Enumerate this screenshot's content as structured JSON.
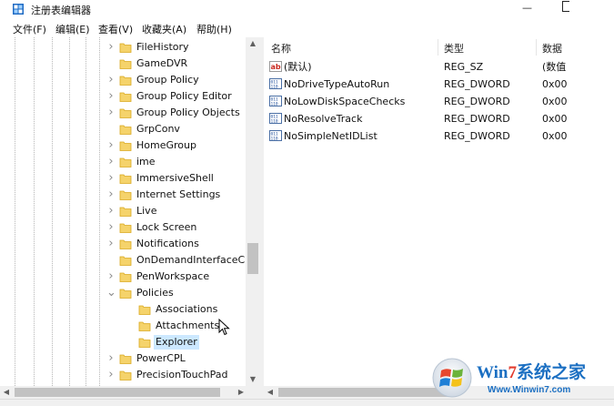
{
  "window": {
    "title": "注册表编辑器",
    "minimize_glyph": "—"
  },
  "menu": {
    "items": [
      "文件(F)",
      "编辑(E)",
      "查看(V)",
      "收藏夹(A)",
      "帮助(H)"
    ]
  },
  "tree": {
    "items": [
      {
        "label": "FileHistory",
        "expander": ">",
        "level": 1
      },
      {
        "label": "GameDVR",
        "expander": "",
        "level": 1
      },
      {
        "label": "Group Policy",
        "expander": ">",
        "level": 1
      },
      {
        "label": "Group Policy Editor",
        "expander": ">",
        "level": 1
      },
      {
        "label": "Group Policy Objects",
        "expander": ">",
        "level": 1
      },
      {
        "label": "GrpConv",
        "expander": "",
        "level": 1
      },
      {
        "label": "HomeGroup",
        "expander": ">",
        "level": 1
      },
      {
        "label": "ime",
        "expander": ">",
        "level": 1
      },
      {
        "label": "ImmersiveShell",
        "expander": ">",
        "level": 1
      },
      {
        "label": "Internet Settings",
        "expander": ">",
        "level": 1
      },
      {
        "label": "Live",
        "expander": ">",
        "level": 1
      },
      {
        "label": "Lock Screen",
        "expander": ">",
        "level": 1
      },
      {
        "label": "Notifications",
        "expander": ">",
        "level": 1
      },
      {
        "label": "OnDemandInterfaceCa",
        "expander": "",
        "level": 1
      },
      {
        "label": "PenWorkspace",
        "expander": ">",
        "level": 1
      },
      {
        "label": "Policies",
        "expander": "v",
        "level": 1
      },
      {
        "label": "Associations",
        "expander": "",
        "level": 2
      },
      {
        "label": "Attachments",
        "expander": "",
        "level": 2
      },
      {
        "label": "Explorer",
        "expander": "",
        "level": 2,
        "selected": true
      },
      {
        "label": "PowerCPL",
        "expander": ">",
        "level": 1
      },
      {
        "label": "PrecisionTouchPad",
        "expander": ">",
        "level": 1
      }
    ]
  },
  "list": {
    "columns": [
      "名称",
      "类型",
      "数据"
    ],
    "rows": [
      {
        "icon": "string-value-icon",
        "name": "(默认)",
        "type": "REG_SZ",
        "data": "(数值"
      },
      {
        "icon": "dword-value-icon",
        "name": "NoDriveTypeAutoRun",
        "type": "REG_DWORD",
        "data": "0x00"
      },
      {
        "icon": "dword-value-icon",
        "name": "NoLowDiskSpaceChecks",
        "type": "REG_DWORD",
        "data": "0x00"
      },
      {
        "icon": "dword-value-icon",
        "name": "NoResolveTrack",
        "type": "REG_DWORD",
        "data": "0x00"
      },
      {
        "icon": "dword-value-icon",
        "name": "NoSimpleNetIDList",
        "type": "REG_DWORD",
        "data": "0x00"
      }
    ]
  },
  "watermark": {
    "brand_prefix": "Win",
    "brand_seven": "7",
    "brand_suffix": "系统之家",
    "url": "Www.Winwin7.com"
  },
  "colors": {
    "folder": "#f5d36b",
    "selection": "#cce8ff",
    "watermark_blue": "#1b6fc2",
    "watermark_red": "#e23b2e"
  }
}
